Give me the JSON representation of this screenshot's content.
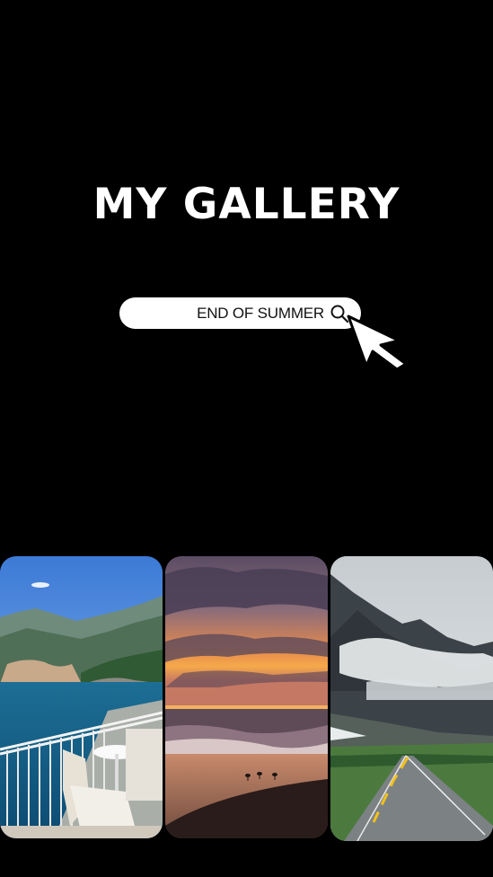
{
  "header": {
    "title": "MY GALLERY"
  },
  "search": {
    "query": "END OF SUMMER",
    "icon": "search-icon"
  },
  "pointer": {
    "icon": "cursor-icon"
  },
  "gallery": {
    "photos": [
      {
        "name": "coastal-town-photo"
      },
      {
        "name": "beach-sunset-photo"
      },
      {
        "name": "mountain-road-photo"
      }
    ]
  },
  "colors": {
    "background": "#000000",
    "text": "#ffffff",
    "search_bg": "#ffffff"
  }
}
